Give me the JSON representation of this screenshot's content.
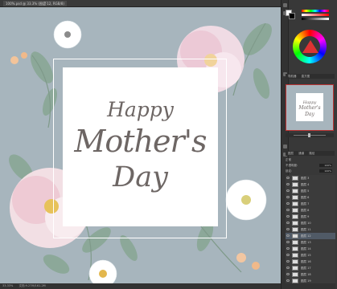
{
  "document_tab": {
    "title": "100%.psd @ 33.3% (图层 12, RGB/8)",
    "close": "×"
  },
  "status_bar": {
    "zoom": "33.33%",
    "info": "文档:9.27M/161.2M"
  },
  "card": {
    "line1": "Happy",
    "line2": "Mother's",
    "line3": "Day"
  },
  "panels": {
    "color_header": [
      "颜色",
      "色板"
    ],
    "navigator_header": [
      "导航器",
      "直方图"
    ],
    "layers_header": [
      "图层",
      "通道",
      "路径"
    ],
    "blend_mode": "正常",
    "opacity_label": "不透明度:",
    "opacity_value": "100%",
    "fill_label": "填充:",
    "fill_value": "100%",
    "lock_label": "锁定:"
  },
  "layers": [
    {
      "name": "图层 3"
    },
    {
      "name": "图层 4"
    },
    {
      "name": "图层 5"
    },
    {
      "name": "图层 6"
    },
    {
      "name": "图层 7"
    },
    {
      "name": "图层 8"
    },
    {
      "name": "图层 9"
    },
    {
      "name": "图层 10"
    },
    {
      "name": "图层 11"
    },
    {
      "name": "图层 12",
      "selected": true
    },
    {
      "name": "图层 13"
    },
    {
      "name": "图层 14"
    },
    {
      "name": "图层 15"
    },
    {
      "name": "图层 16"
    },
    {
      "name": "图层 17"
    },
    {
      "name": "图层 18"
    },
    {
      "name": "图层 19"
    }
  ],
  "colors": {
    "canvas_bg": "#a7b5bd",
    "text": "#6d6664",
    "selection": "#b33333"
  }
}
